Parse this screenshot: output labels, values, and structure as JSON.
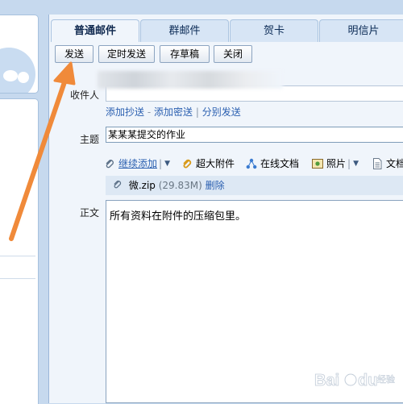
{
  "tabs": [
    {
      "label": "普通邮件",
      "active": true
    },
    {
      "label": "群邮件",
      "active": false
    },
    {
      "label": "贺卡",
      "active": false
    },
    {
      "label": "明信片",
      "active": false
    }
  ],
  "toolbar": {
    "send": "发送",
    "scheduled_send": "定时发送",
    "save_draft": "存草稿",
    "close": "关闭"
  },
  "recipient": {
    "label": "收件人",
    "value": ""
  },
  "cc_links": {
    "add_cc": "添加抄送",
    "dash": "-",
    "add_bcc": "添加密送",
    "pipe": "|",
    "separate_send": "分别发送"
  },
  "subject": {
    "label": "主题",
    "value": "某某某提交的作业"
  },
  "attach_toolbar": {
    "continue_add": "继续添加",
    "big_attachment": "超大附件",
    "online_doc": "在线文档",
    "photo": "照片",
    "doc": "文档",
    "pipe": "|"
  },
  "attachment": {
    "filename": "微.zip",
    "size": "(29.83M)",
    "delete": "删除"
  },
  "body": {
    "label": "正文",
    "text": "所有资料在附件的压缩包里。"
  },
  "colors": {
    "arrow": "#f08a3a",
    "link": "#2a5fb0",
    "page_bg": "#c6d9ee"
  },
  "watermark": {
    "logo_text": "Bai du",
    "sub_text": "经验"
  }
}
